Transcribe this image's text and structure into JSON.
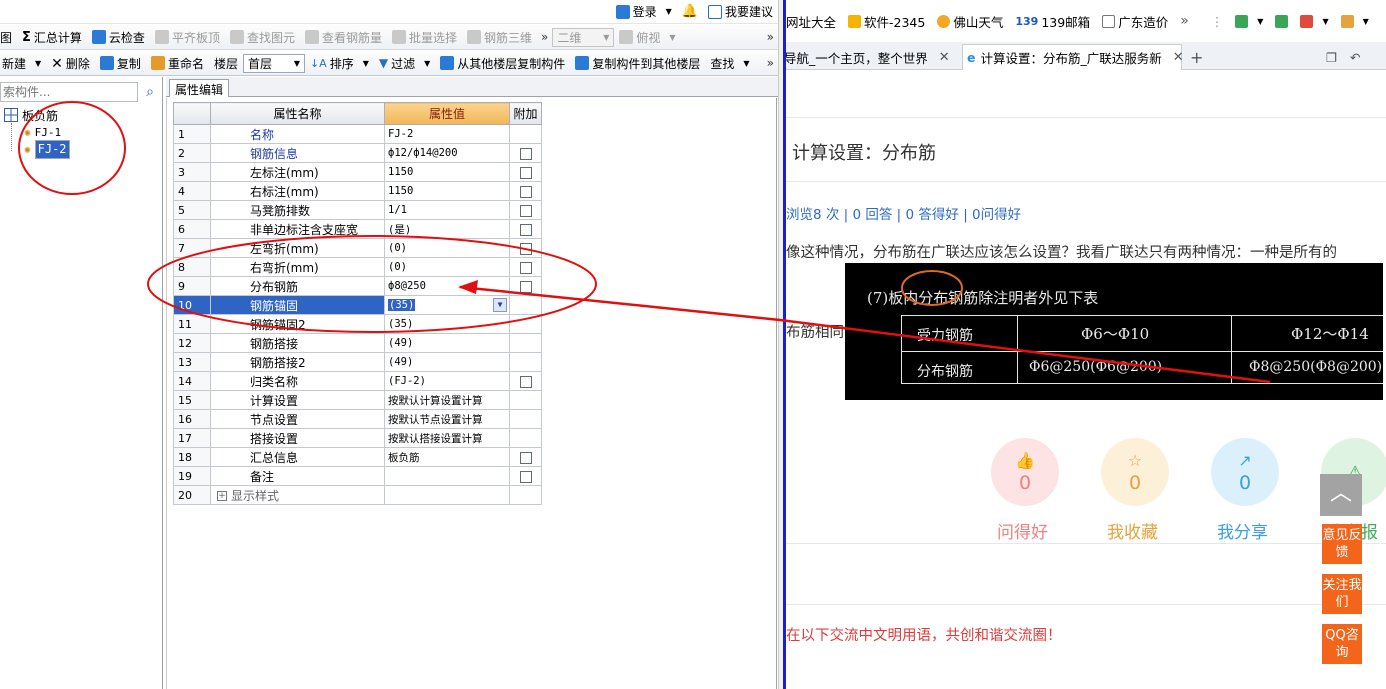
{
  "app": {
    "top_right": {
      "login": "登录",
      "feedback": "我要建议"
    },
    "toolbar1": {
      "cut_label": "图",
      "summary": "汇总计算",
      "cloud_check": "云检查",
      "flat_top": "平齐板顶",
      "find_element": "查找图元",
      "view_rebar": "查看钢筋量",
      "batch_select": "批量选择",
      "rebar_3d": "钢筋三维",
      "view_2d": "二维",
      "view_mode": "俯视"
    },
    "toolbar2": {
      "new": "新建",
      "delete": "删除",
      "copy": "复制",
      "rename": "重命名",
      "floor_label": "楼层",
      "floor_value": "首层",
      "sort": "排序",
      "filter": "过滤",
      "copy_from": "从其他楼层复制构件",
      "copy_to": "复制构件到其他楼层",
      "find": "查找"
    },
    "search": {
      "placeholder": "索构件..."
    },
    "tree": {
      "root": "板负筋",
      "items": [
        "FJ-1",
        "FJ-2"
      ]
    },
    "tab": "属性编辑",
    "grid": {
      "headers": [
        "属性名称",
        "属性值",
        "附加"
      ],
      "rows": [
        {
          "n": "1",
          "name": "名称",
          "value": "FJ-2",
          "blue": true,
          "chk": false
        },
        {
          "n": "2",
          "name": "钢筋信息",
          "value": "ф12/ф14@200",
          "blue": true,
          "chk": true
        },
        {
          "n": "3",
          "name": "左标注(mm)",
          "value": "1150",
          "blue": false,
          "chk": true
        },
        {
          "n": "4",
          "name": "右标注(mm)",
          "value": "1150",
          "blue": false,
          "chk": true
        },
        {
          "n": "5",
          "name": "马凳筋排数",
          "value": "1/1",
          "blue": false,
          "chk": true
        },
        {
          "n": "6",
          "name": "非单边标注含支座宽",
          "value": "(是)",
          "blue": false,
          "chk": true
        },
        {
          "n": "7",
          "name": "左弯折(mm)",
          "value": "(0)",
          "blue": false,
          "chk": true
        },
        {
          "n": "8",
          "name": "右弯折(mm)",
          "value": "(0)",
          "blue": false,
          "chk": true
        },
        {
          "n": "9",
          "name": "分布钢筋",
          "value": "ф8@250",
          "blue": false,
          "chk": true
        },
        {
          "n": "10",
          "name": "钢筋锚固",
          "value": "(35)",
          "blue": false,
          "chk": false,
          "selected": true
        },
        {
          "n": "11",
          "name": "钢筋锚固2",
          "value": "(35)",
          "blue": false,
          "chk": false
        },
        {
          "n": "12",
          "name": "钢筋搭接",
          "value": "(49)",
          "blue": false,
          "chk": false
        },
        {
          "n": "13",
          "name": "钢筋搭接2",
          "value": "(49)",
          "blue": false,
          "chk": false
        },
        {
          "n": "14",
          "name": "归类名称",
          "value": "(FJ-2)",
          "blue": false,
          "chk": true
        },
        {
          "n": "15",
          "name": "计算设置",
          "value": "按默认计算设置计算",
          "blue": false,
          "chk": false
        },
        {
          "n": "16",
          "name": "节点设置",
          "value": "按默认节点设置计算",
          "blue": false,
          "chk": false
        },
        {
          "n": "17",
          "name": "搭接设置",
          "value": "按默认搭接设置计算",
          "blue": false,
          "chk": false
        },
        {
          "n": "18",
          "name": "汇总信息",
          "value": "板负筋",
          "blue": false,
          "chk": true
        },
        {
          "n": "19",
          "name": "备注",
          "value": "",
          "blue": false,
          "chk": true
        },
        {
          "n": "20",
          "name": "显示样式",
          "value": "",
          "blue": false,
          "chk": false,
          "expand": true
        }
      ]
    }
  },
  "browser": {
    "bookmarks": [
      "网址大全",
      "软件-2345",
      "佛山天气",
      "139邮箱",
      "广东造价"
    ],
    "bookmark_139": "139",
    "tabs": [
      {
        "label": "导航_一个主页，整个世界",
        "active": false
      },
      {
        "label": "计算设置：分布筋_广联达服务新",
        "active": true
      }
    ],
    "page": {
      "title": "计算设置：分布筋",
      "stats": "浏览8 次 | 0 回答 | 0 答得好 | 0问得好",
      "body": "像这种情况，分布筋在广联达应该怎么设置？我看广联达只有两种情况：一种是所有的",
      "body2": "布筋相同",
      "image": {
        "heading": "(7)板内分布钢筋除注明者外见下表",
        "col1": "受力钢筋",
        "col2": "Φ6～Φ10",
        "col3": "Φ12～Φ14",
        "row2_label": "分布钢筋",
        "row2_v1": "Φ6@250(Φ6@200)",
        "row2_v2": "Φ8@250(Φ8@200)"
      },
      "actions": [
        {
          "count": "0",
          "label": "问得好",
          "color": "#f08080",
          "bg": "#fde3e3"
        },
        {
          "count": "0",
          "label": "我收藏",
          "color": "#e6a23c",
          "bg": "#fdf0d9"
        },
        {
          "count": "0",
          "label": "我分享",
          "color": "#3b9ee0",
          "bg": "#dcf0fb"
        },
        {
          "count": "",
          "label": "我举报",
          "color": "#3fae5a",
          "bg": "#dff3e3"
        }
      ],
      "civil_notice": "在以下交流中文明用语，共创和谐交流圈！",
      "side": [
        "意见反馈",
        "关注我们",
        "QQ咨询"
      ]
    }
  },
  "colors": {
    "annotation": "#e01010",
    "selection": "#2f64c4"
  }
}
